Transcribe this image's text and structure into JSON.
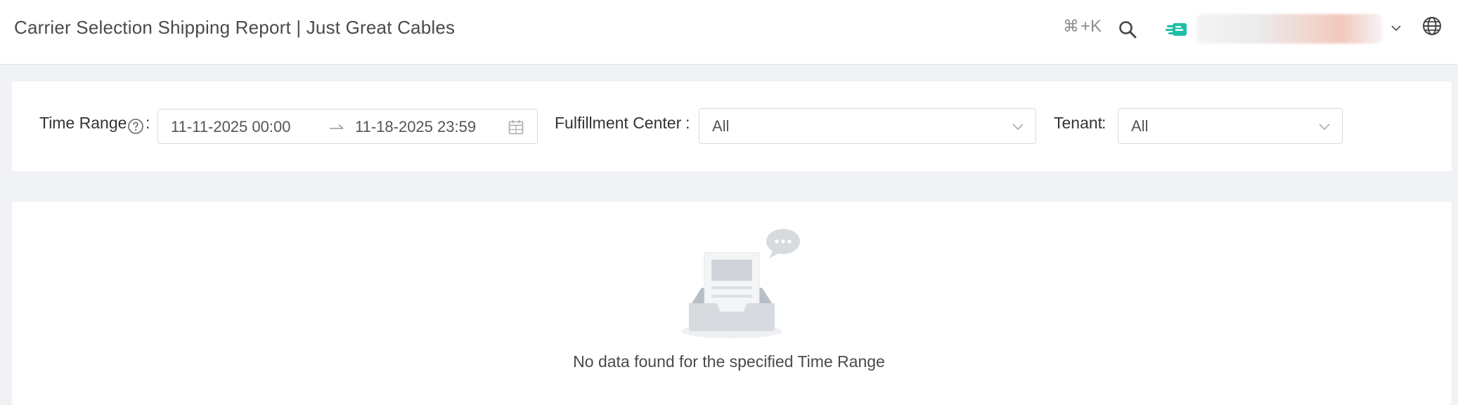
{
  "header": {
    "title": "Carrier Selection Shipping Report | Just Great Cables",
    "shortcut_symbol": "⌘",
    "shortcut_key": "+K",
    "icons": [
      "search-icon",
      "brand-logo-icon",
      "chevron-down-icon",
      "globe-icon"
    ],
    "accent_color": "#1fbfa7"
  },
  "filters": {
    "time_range": {
      "label": "Time Range",
      "start": "11-11-2025 00:00",
      "end": "11-18-2025 23:59"
    },
    "fulfillment_center": {
      "label": "Fulfillment Center",
      "value": "All"
    },
    "tenant": {
      "label": "Tenant",
      "value": "All"
    },
    "separator": ":"
  },
  "results": {
    "empty_message": "No data found for the specified Time Range"
  }
}
